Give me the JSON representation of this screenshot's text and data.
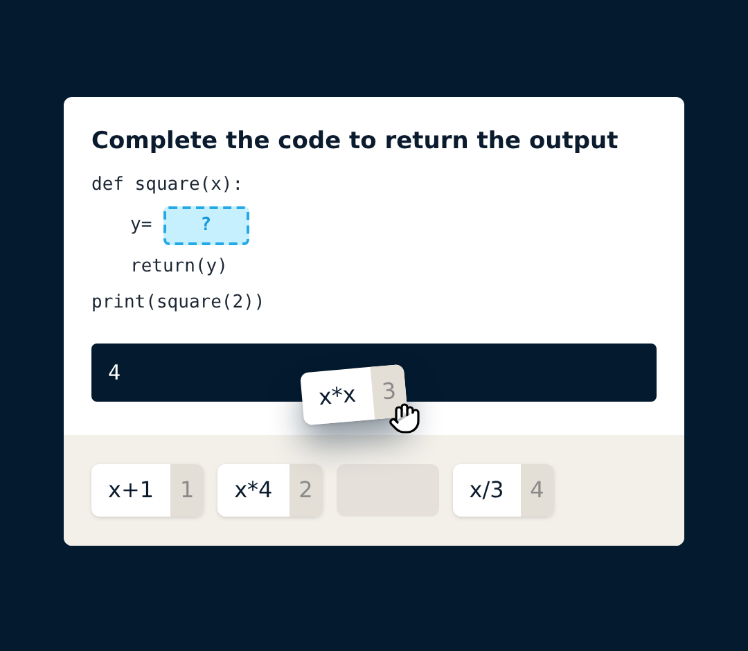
{
  "question": {
    "title": "Complete the code to return the output"
  },
  "code": [
    {
      "kind": "line",
      "indent": false,
      "text": "def square(x):"
    },
    {
      "kind": "blank",
      "indent": true,
      "prefix": "y=",
      "placeholder": "?"
    },
    {
      "kind": "line",
      "indent": true,
      "text": "return(y)"
    },
    {
      "kind": "line",
      "indent": false,
      "text": "print(square(2))"
    }
  ],
  "output": {
    "text": "4"
  },
  "dragged_tile": {
    "label": "x*x",
    "key": "3"
  },
  "options": [
    {
      "kind": "tile",
      "label": "x+1",
      "key": "1"
    },
    {
      "kind": "tile",
      "label": "x*4",
      "key": "2"
    },
    {
      "kind": "empty"
    },
    {
      "kind": "tile",
      "label": "x/3",
      "key": "4"
    }
  ]
}
